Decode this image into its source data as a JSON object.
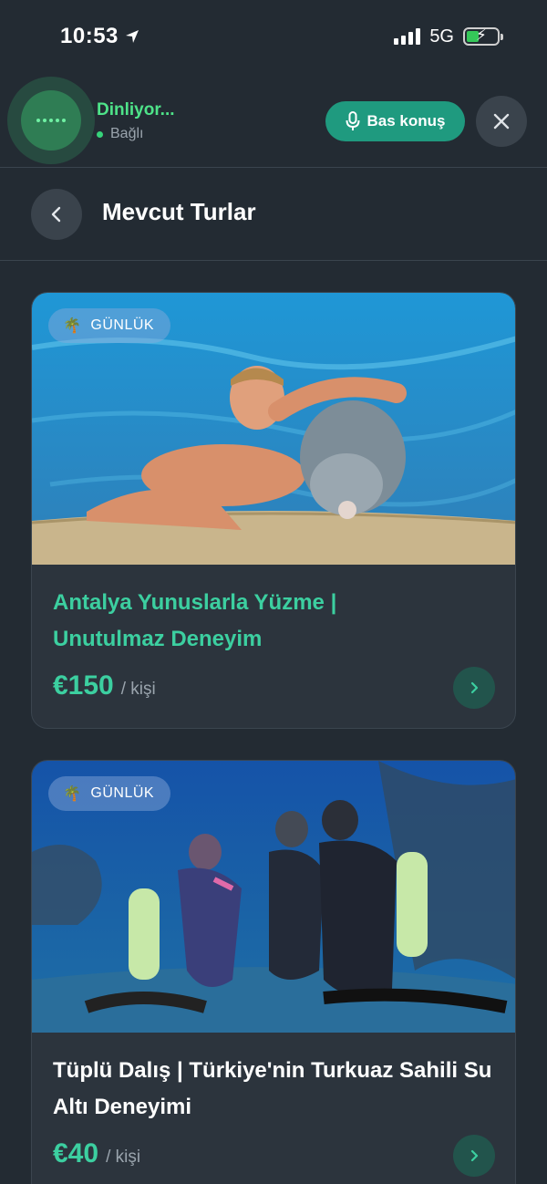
{
  "status_bar": {
    "time": "10:53",
    "network": "5G",
    "location_icon": "location-arrow-icon",
    "battery_color": "#35c759"
  },
  "voice": {
    "listening_label": "Dinliyor...",
    "connected_label": "Bağlı",
    "talk_button_label": "Bas konuş",
    "mic_icon": "microphone-icon",
    "close_icon": "close-icon",
    "accent_color": "#4ee389"
  },
  "header": {
    "title": "Mevcut Turlar",
    "back_icon": "chevron-left-icon"
  },
  "tours": [
    {
      "badge": "GÜNLÜK",
      "badge_icon": "palm-tree-icon",
      "title": "Antalya Yunuslarla Yüzme | Unutulmaz Deneyim",
      "price": "€150",
      "per": "/ kişi",
      "title_color": "#3ccfa0"
    },
    {
      "badge": "GÜNLÜK",
      "badge_icon": "palm-tree-icon",
      "title": "Tüplü Dalış | Türkiye'nin Turkuaz Sahili Su Altı Deneyimi",
      "price": "€40",
      "per": "/ kişi",
      "title_color": "#ffffff"
    }
  ]
}
